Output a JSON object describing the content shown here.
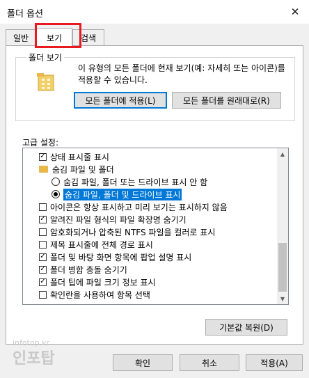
{
  "window": {
    "title": "폴더 옵션",
    "close_glyph": "✕"
  },
  "tabs": [
    {
      "label": "일반"
    },
    {
      "label": "보기"
    },
    {
      "label": "검색"
    }
  ],
  "folder_views": {
    "legend": "폴더 보기",
    "description": "이 유형의 모든 폴더에 현재 보기(예: 자세히 또는 아이콘)를 적용할 수 있습니다.",
    "apply_button": "모든 폴더에 적용(L)",
    "reset_button": "모든 폴더를 원래대로(R)"
  },
  "advanced": {
    "label": "고급 설정:",
    "items": [
      {
        "type": "checkbox",
        "checked": true,
        "label": "상태 표시줄 표시"
      },
      {
        "type": "folder",
        "label": "숨김 파일 및 폴더"
      },
      {
        "type": "radio",
        "checked": false,
        "label": "숨김 파일, 폴더 또는 드라이브 표시 안 함"
      },
      {
        "type": "radio",
        "checked": true,
        "label": "숨김 파일, 폴더 및 드라이브 표시",
        "selected": true
      },
      {
        "type": "checkbox",
        "checked": false,
        "label": "아이콘은 항상 표시하고 미리 보기는 표시하지 않음"
      },
      {
        "type": "checkbox",
        "checked": true,
        "label": "알려진 파일 형식의 파일 확장명 숨기기"
      },
      {
        "type": "checkbox",
        "checked": false,
        "label": "암호화되거나 압축된 NTFS 파일을 컬러로 표시"
      },
      {
        "type": "checkbox",
        "checked": false,
        "label": "제목 표시줄에 전체 경로 표시"
      },
      {
        "type": "checkbox",
        "checked": true,
        "label": "폴더 및 바탕 화면 항목에 팝업 설명 표시"
      },
      {
        "type": "checkbox",
        "checked": true,
        "label": "폴더 병합 충돌 숨기기"
      },
      {
        "type": "checkbox",
        "checked": true,
        "label": "폴더 팁에 파일 크기 정보 표시"
      },
      {
        "type": "checkbox",
        "checked": false,
        "label": "확인란을 사용하여 항목 선택"
      }
    ],
    "restore_button": "기본값 복원(D)"
  },
  "watermark": {
    "small": "infotop.kr",
    "big": "인포탑"
  },
  "footer": {
    "ok": "확인",
    "cancel": "취소",
    "apply": "적용(A)"
  }
}
